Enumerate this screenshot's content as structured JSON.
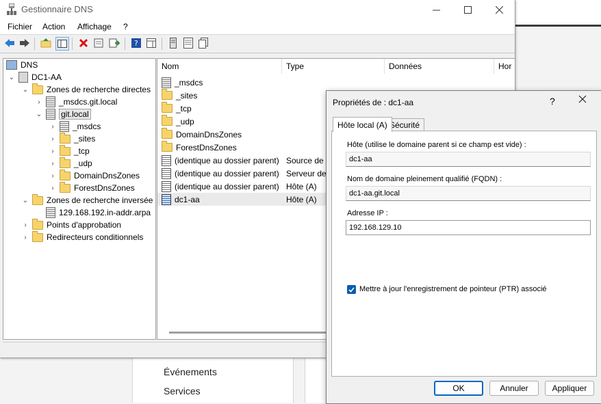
{
  "window": {
    "title": "Gestionnaire DNS"
  },
  "menu": [
    "Fichier",
    "Action",
    "Affichage",
    "?"
  ],
  "tree": {
    "root": "DNS",
    "server": "DC1-AA",
    "forward_zones": "Zones de recherche directes",
    "msdcs_zone": "_msdcs.git.local",
    "git_zone": "git.local",
    "git_children": [
      "_msdcs",
      "_sites",
      "_tcp",
      "_udp",
      "DomainDnsZones",
      "ForestDnsZones"
    ],
    "reverse_zones": "Zones de recherche inversée",
    "reverse_zone": "129.168.192.in-addr.arpa",
    "trust_points": "Points d'approbation",
    "conditional_forwarders": "Redirecteurs conditionnels"
  },
  "list": {
    "columns": [
      "Nom",
      "Type",
      "Données",
      "Hor"
    ],
    "rows": [
      {
        "name": "_msdcs",
        "type": "",
        "icon": "zone"
      },
      {
        "name": "_sites",
        "type": "",
        "icon": "folder"
      },
      {
        "name": "_tcp",
        "type": "",
        "icon": "folder"
      },
      {
        "name": "_udp",
        "type": "",
        "icon": "folder"
      },
      {
        "name": "DomainDnsZones",
        "type": "",
        "icon": "folder"
      },
      {
        "name": "ForestDnsZones",
        "type": "",
        "icon": "folder"
      },
      {
        "name": "(identique au dossier parent)",
        "type": "Source de n",
        "icon": "record"
      },
      {
        "name": "(identique au dossier parent)",
        "type": "Serveur de n",
        "icon": "record"
      },
      {
        "name": "(identique au dossier parent)",
        "type": "Hôte (A)",
        "icon": "record"
      },
      {
        "name": "dc1-aa",
        "type": "Hôte (A)",
        "icon": "record-selected"
      }
    ]
  },
  "background": {
    "items": [
      "Événements",
      "Services"
    ]
  },
  "dialog": {
    "title": "Propriétés de : dc1-aa",
    "help": "?",
    "tabs": [
      "Hôte local (A)",
      "Sécurité"
    ],
    "host_label": "Hôte (utilise le domaine parent si ce champ est vide) :",
    "host_value": "dc1-aa",
    "fqdn_label": "Nom de domaine pleinement qualifié (FQDN) :",
    "fqdn_value": "dc1-aa.git.local",
    "ip_label": "Adresse IP :",
    "ip_value": "192.168.129.10",
    "ptr_label": "Mettre à jour l'enregistrement de pointeur (PTR) associé",
    "ptr_checked": true,
    "buttons": {
      "ok": "OK",
      "cancel": "Annuler",
      "apply": "Appliquer"
    }
  },
  "colors": {
    "accent": "#0067c0",
    "checkbox": "#0b5cad",
    "folder": "#f7d46b"
  }
}
